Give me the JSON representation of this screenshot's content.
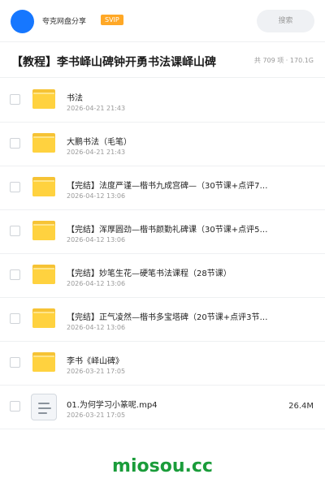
{
  "header": {
    "app_name": "夸克网盘分享",
    "badge": "SVIP",
    "search_label": "搜索"
  },
  "share": {
    "title": "【教程】李书峄山碑钟开勇书法课峄山碑",
    "meta": "共 709 项 · 170.1G"
  },
  "items": [
    {
      "type": "folder",
      "name": "书法",
      "date": "2026-04-21 21:43"
    },
    {
      "type": "folder",
      "name": "大鹏书法（毛笔）",
      "date": "2026-04-21 21:43"
    },
    {
      "type": "folder",
      "name": "【完结】法度严谨—楷书九成宫碑—（30节课+点评7…",
      "date": "2026-04-12 13:06"
    },
    {
      "type": "folder",
      "name": "【完结】浑厚圆劲—楷书颜勤礼碑课（30节课+点评5…",
      "date": "2026-04-12 13:06"
    },
    {
      "type": "folder",
      "name": "【完结】妙笔生花—硬笔书法课程（28节课）",
      "date": "2026-04-12 13:06"
    },
    {
      "type": "folder",
      "name": "【完结】正气凌然—楷书多宝塔碑（20节课+点评3节…",
      "date": "2026-04-12 13:06"
    },
    {
      "type": "folder",
      "name": "李书《峄山碑》",
      "date": "2026-03-21 17:05"
    },
    {
      "type": "file",
      "name": "01.为何学习小篆呢.mp4",
      "date": "2026-03-21 17:05",
      "size": "26.4M"
    }
  ],
  "watermark": "miosou.cc",
  "colors": {
    "avatar": "#1677ff",
    "badge": "#ffa826",
    "folder": "#ffd23f",
    "watermark": "#1a9c3a"
  }
}
